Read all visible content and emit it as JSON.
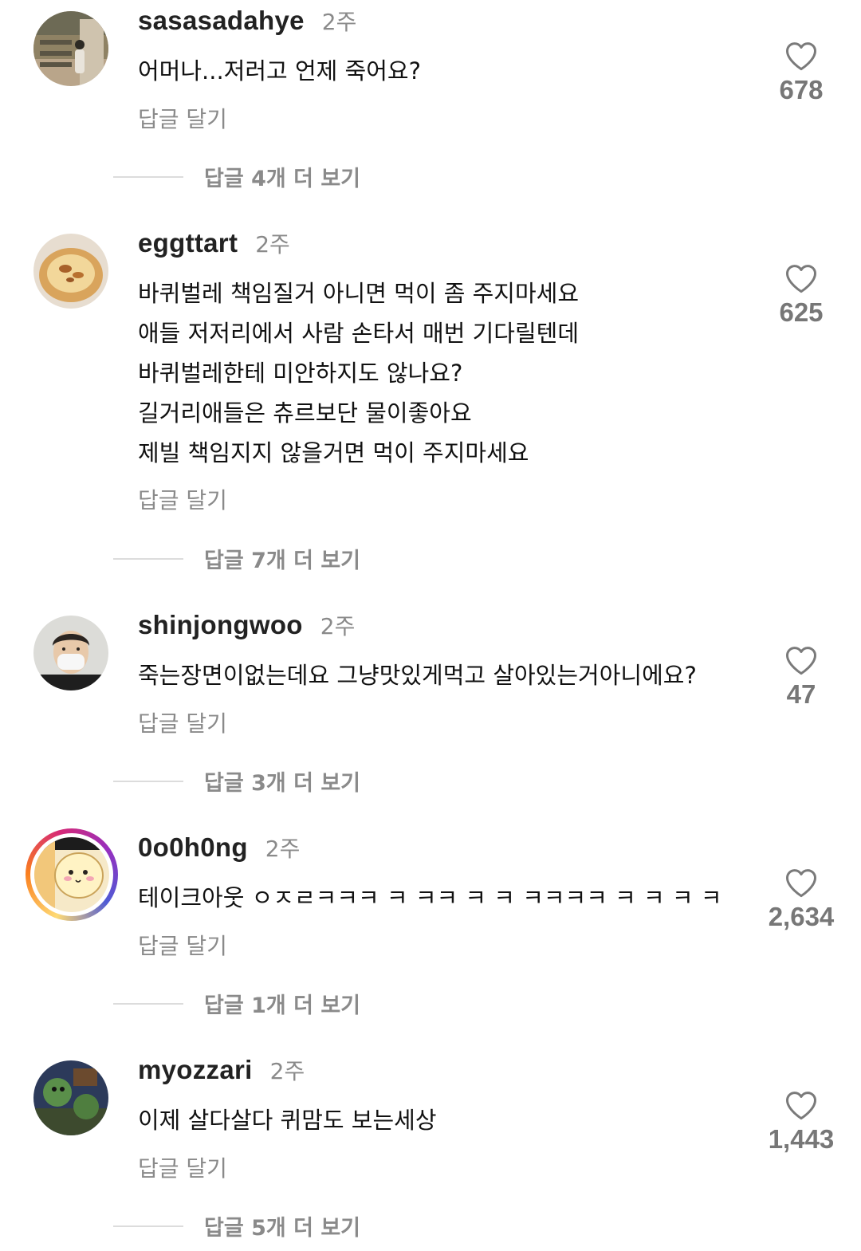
{
  "comments": [
    {
      "username": "sasasadahye",
      "time": "2주",
      "lines": [
        "어머나...저러고 언제 죽어요?"
      ],
      "reply": "답글 달기",
      "likes": "678",
      "more_replies": "답글 4개 더 보기"
    },
    {
      "username": "eggttart",
      "time": "2주",
      "lines": [
        "바퀴벌레 책임질거 아니면 먹이 좀 주지마세요",
        "애들 저저리에서 사람 손타서 매번 기다릴텐데",
        "바퀴벌레한테 미안하지도 않나요?",
        "길거리애들은 츄르보단 물이좋아요",
        "제빌 책임지지 않을거면 먹이 주지마세요"
      ],
      "reply": "답글 달기",
      "likes": "625",
      "more_replies": "답글 7개 더 보기"
    },
    {
      "username": "shinjongwoo",
      "time": "2주",
      "lines": [
        "죽는장면이없는데요 그냥맛있게먹고 살아있는거아니에요?"
      ],
      "reply": "답글 달기",
      "likes": "47",
      "more_replies": "답글 3개 더 보기"
    },
    {
      "username": "0o0h0ng",
      "time": "2주",
      "lines": [
        "테이크아웃 ㅇㅈㄹㅋㅋㅋ ㅋ ㅋㅋ ㅋ ㅋ ㅋㅋㅋㅋ ㅋ ㅋ ㅋ ㅋ"
      ],
      "reply": "답글 달기",
      "likes": "2,634",
      "more_replies": "답글 1개 더 보기"
    },
    {
      "username": "myozzari",
      "time": "2주",
      "lines": [
        "이제 살다살다 퀴맘도 보는세상"
      ],
      "reply": "답글 달기",
      "likes": "1,443",
      "more_replies": "답글 5개 더 보기"
    }
  ],
  "icons": {
    "like": "heart-outline-icon"
  },
  "colors": {
    "text": "#111111",
    "muted": "#8a8a8a",
    "like_count": "#777777",
    "divider": "#dcdcdc"
  }
}
